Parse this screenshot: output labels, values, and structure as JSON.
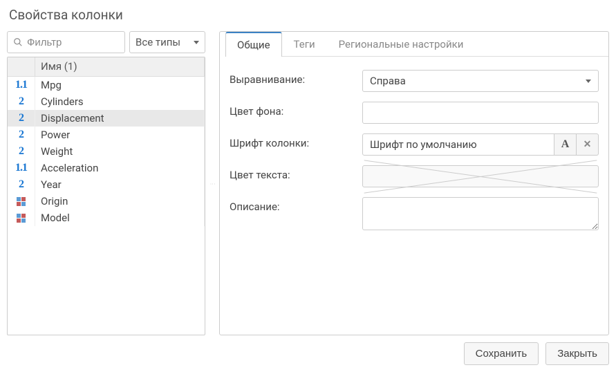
{
  "title": "Свойства колонки",
  "filter": {
    "placeholder": "Фильтр"
  },
  "type_filter": {
    "label": "Все типы"
  },
  "grid": {
    "header_name": "Имя (1)",
    "rows": [
      {
        "type": "float",
        "name": "Mpg",
        "selected": false
      },
      {
        "type": "int",
        "name": "Cylinders",
        "selected": false
      },
      {
        "type": "int",
        "name": "Displacement",
        "selected": true
      },
      {
        "type": "int",
        "name": "Power",
        "selected": false
      },
      {
        "type": "int",
        "name": "Weight",
        "selected": false
      },
      {
        "type": "float",
        "name": "Acceleration",
        "selected": false
      },
      {
        "type": "int",
        "name": "Year",
        "selected": false
      },
      {
        "type": "cat",
        "name": "Origin",
        "selected": false
      },
      {
        "type": "cat",
        "name": "Model",
        "selected": false
      }
    ]
  },
  "tabs": [
    {
      "id": "general",
      "label": "Общие",
      "active": true
    },
    {
      "id": "tags",
      "label": "Теги",
      "active": false
    },
    {
      "id": "regional",
      "label": "Региональные настройки",
      "active": false
    }
  ],
  "form": {
    "alignment": {
      "label": "Выравнивание:",
      "value": "Справа"
    },
    "bgcolor": {
      "label": "Цвет фона:",
      "value": ""
    },
    "font": {
      "label": "Шрифт колонки:",
      "value": "Шрифт по умолчанию"
    },
    "textcolor": {
      "label": "Цвет текста:",
      "value": ""
    },
    "description": {
      "label": "Описание:",
      "value": ""
    }
  },
  "buttons": {
    "save": "Сохранить",
    "close": "Закрыть"
  },
  "type_glyphs": {
    "float": "1.1",
    "int": "2"
  }
}
